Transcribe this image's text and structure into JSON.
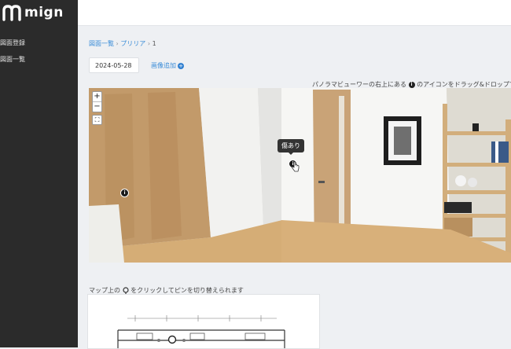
{
  "app": {
    "logo_text": "mign"
  },
  "sidebar": {
    "items": [
      {
        "label": "図面登録"
      },
      {
        "label": "図面一覧"
      }
    ]
  },
  "breadcrumb": {
    "items": [
      "図面一覧",
      "プリリア",
      "1"
    ],
    "separator": "›"
  },
  "date": {
    "value": "2024-05-28"
  },
  "add_image": {
    "label": "画像追加"
  },
  "hint_top": {
    "before": "パノラマビューワーの右上にある",
    "after": "のアイコンをドラッグ&ドロップで注釈"
  },
  "viewer": {
    "zoom_in": "+",
    "zoom_out": "−",
    "fullscreen": "⛶",
    "tooltip": "傷あり",
    "pin_glyph": "i"
  },
  "map": {
    "hint_before": "マップ上の",
    "hint_after": "をクリックしてピンを切り替えられます"
  },
  "colors": {
    "sidebar": "#2b2b2b",
    "accent": "#3b8dd8",
    "background": "#eef0f3"
  }
}
